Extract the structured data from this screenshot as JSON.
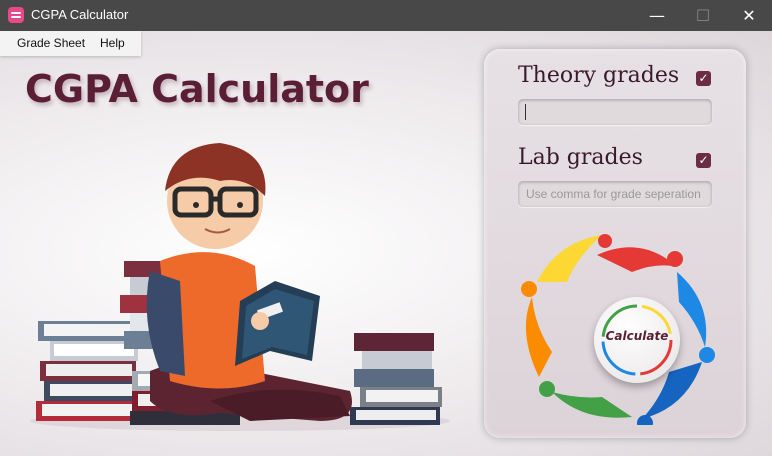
{
  "window": {
    "title": "CGPA Calculator",
    "minimize": "—",
    "maximize": "☐",
    "close": "✕"
  },
  "menu": {
    "items": [
      "Grade Sheet",
      "Help"
    ]
  },
  "header": {
    "title": "CGPA Calculator"
  },
  "form": {
    "theory_label": "Theory grades",
    "theory_checked": true,
    "theory_value": "",
    "lab_label": "Lab grades",
    "lab_checked": true,
    "lab_placeholder": "Use comma for grade seperation",
    "calculate_label": "Calculate"
  },
  "icons": {
    "app": "calculator-icon",
    "check": "✓"
  },
  "colors": {
    "accent": "#5b1f35",
    "checkbox": "#6b2d43"
  }
}
